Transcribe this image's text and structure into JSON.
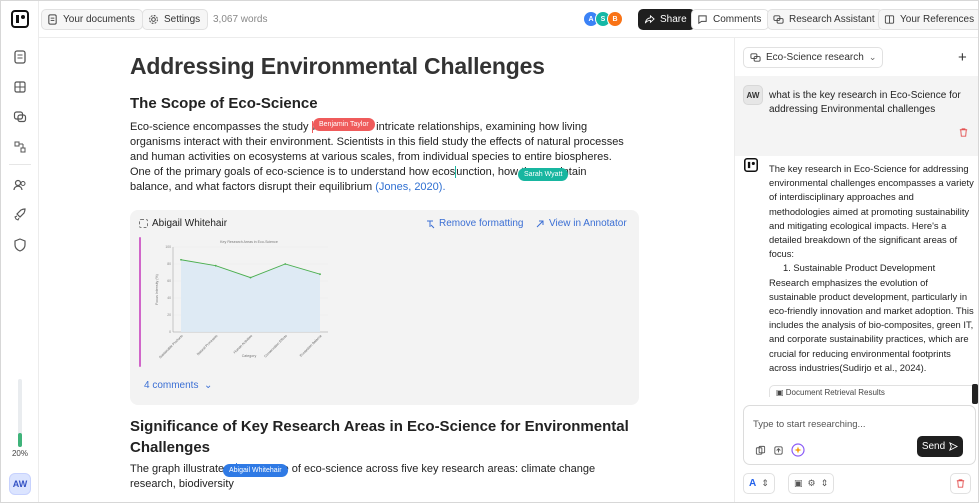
{
  "topbar": {
    "your_documents": "Your documents",
    "settings": "Settings",
    "word_count": "3,067 words",
    "collaborators": [
      {
        "initial": "A",
        "color": "#3b82f6"
      },
      {
        "initial": "S",
        "color": "#14b8a6"
      },
      {
        "initial": "B",
        "color": "#f97316"
      }
    ],
    "share": "Share",
    "comments": "Comments",
    "research_assistant": "Research Assistant",
    "your_references": "Your References"
  },
  "sidebar": {
    "progress_percent": 20,
    "progress_label": "20%",
    "user_initials": "AW"
  },
  "document": {
    "title": "Addressing Environmental Challenges",
    "section1_heading": "The Scope of Eco-Science",
    "p1_a": "Eco-science encompasses the study ",
    "p1_b": "ms and their intricate relationships, examining how living organisms interact with their environment. Scientists in this field study the effects of natural processes and human activities on ecosystems at various scales, from individual species to entire biospheres. One of the primary goals of eco-science is to understand how ecos",
    "p1_c": "unction, how they maintain balance, and what factors disrupt their equilibrium ",
    "p1_cite": "(Jones, 2020).",
    "cursor_tags": [
      {
        "name": "Benjamin Taylor",
        "color": "#ef5b5b"
      },
      {
        "name": "Sarah Wyatt",
        "color": "#18b6a0"
      },
      {
        "name": "Abigail Whitehair",
        "color": "#2f7ae5"
      }
    ],
    "comment_block": {
      "author": "Abigail Whitehair",
      "remove_formatting": "Remove formatting",
      "view_in_annotator": "View in Annotator",
      "comments_count": "4 comments"
    },
    "section2_heading": "Significance of Key Research Areas in Eco-Science for Environmental Challenges",
    "p2_a": "The graph illustrates t",
    "p2_b": "mportance of eco-science across five key research areas: climate change research, biodiversity"
  },
  "chart_data": {
    "type": "area",
    "title": "Key Research Areas in Eco-Science",
    "xlabel": "Category",
    "ylabel": "Focus Intensity (%)",
    "categories": [
      "Sustainable Products",
      "Natural Processes",
      "Human Activities",
      "Conservation Efforts",
      "Ecosystem Balance"
    ],
    "values": [
      85,
      78,
      64,
      80,
      68
    ],
    "ylim": [
      0,
      100
    ],
    "color": "#4caf50"
  },
  "panel": {
    "dropdown_label": "Eco-Science research",
    "question_avatar": "AW",
    "question": "what is the key research in Eco-Science for addressing Environmental challenges",
    "answer_intro": "The key research in Eco-Science for addressing environmental challenges encompasses a variety of interdisciplinary approaches and methodologies aimed at promoting sustainability and mitigating ecological impacts. Here's a detailed breakdown of the significant areas of focus:",
    "answer_item": "1.  Sustainable Product Development",
    "answer_body": "Research emphasizes the evolution of sustainable product development, particularly in eco-friendly innovation and market adoption. This includes the analysis of bio-composites, green IT, and corporate sustainability practices, which are crucial for reducing environmental footprints across industries(Sudirjo et al., 2024).",
    "retrieval_label": "Document Retrieval Results",
    "input_placeholder": "Type to start researching...",
    "send": "Send"
  }
}
